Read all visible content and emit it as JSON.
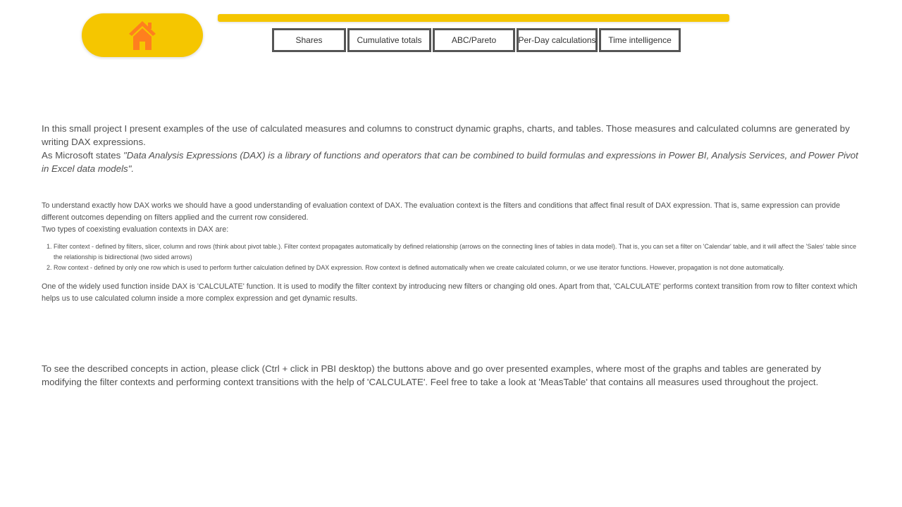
{
  "home": {
    "icon": "home-icon",
    "accent": "#f5c600",
    "icon_color": "#ff7f1e"
  },
  "nav": {
    "buttons": [
      {
        "label": "Shares"
      },
      {
        "label": "Cumulative totals"
      },
      {
        "label": "ABC/Pareto"
      },
      {
        "label": "Per-Day calculations"
      },
      {
        "label": "Time intelligence"
      }
    ]
  },
  "intro": {
    "p1": "In this small project I present examples of the use of calculated measures and columns to construct dynamic graphs, charts, and tables. Those measures and calculated columns are generated by writing DAX expressions.",
    "p2_prefix": "As Microsoft states ",
    "p2_quote": "\"Data Analysis Expressions (DAX) is a library of functions and operators that can be combined to build formulas and expressions in Power BI, Analysis Services, and Power Pivot in Excel data models\"."
  },
  "detail": {
    "p1": "To understand exactly how DAX works we should have a good understanding of evaluation context of DAX. The evaluation context is the filters and conditions that affect final result of DAX expression. That is, same expression can provide different outcomes depending on filters applied and the current row considered.",
    "p2": "Two types of coexisting evaluation contexts in DAX are:",
    "list": [
      "Filter context - defined by filters, slicer, column and rows (think about pivot table.). Filter context propagates automatically by defined relationship (arrows on the connecting lines of tables in data model). That is, you can set a filter on 'Calendar' table, and it will affect the 'Sales' table since the relationship is bidirectional (two sided arrows)",
      "Row context - defined by only one row which is used to perform further calculation defined by DAX expression. Row context is defined automatically when we create calculated column, or we use iterator functions. However, propagation is not done automatically."
    ],
    "p3": "One of the widely used function inside DAX is 'CALCULATE' function. It is used to modify the filter context by introducing new filters or changing old ones. Apart from that, 'CALCULATE' performs context transition from row to filter context which helps us to use calculated column inside a more complex expression and get dynamic results."
  },
  "outro": {
    "p1": "To see the described concepts in action, please click (Ctrl + click in PBI desktop) the buttons above and go over presented examples, where most of the graphs and tables are generated by modifying the filter contexts and performing context transitions with the help of 'CALCULATE'. Feel free to take a look at 'MeasTable' that contains all measures used throughout the project."
  }
}
